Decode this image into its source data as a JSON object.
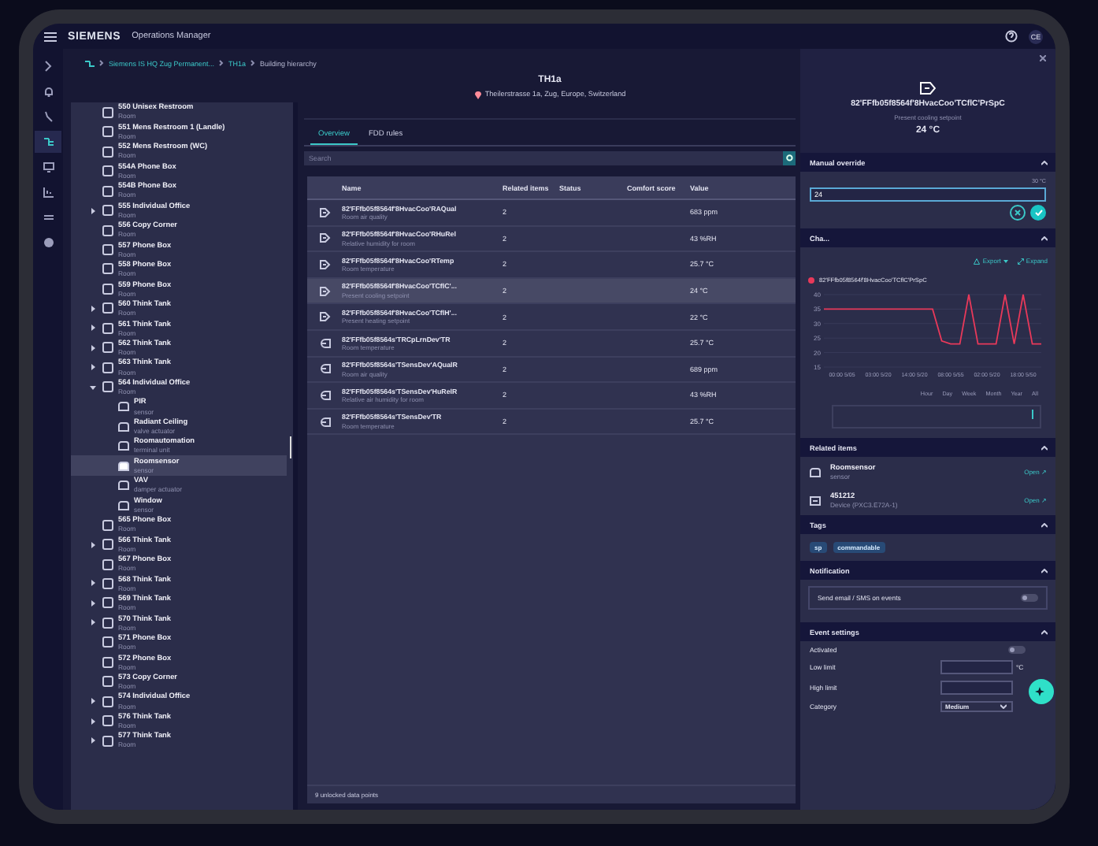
{
  "app": {
    "brand": "SIEMENS",
    "title": "Operations Manager",
    "avatar": "CE"
  },
  "nav": [
    {
      "selected": false
    },
    {
      "selected": false
    },
    {
      "selected": false
    },
    {
      "selected": true
    },
    {
      "selected": false
    },
    {
      "selected": false
    },
    {
      "selected": false
    },
    {
      "selected": false
    }
  ],
  "breadcrumb": [
    "Siemens IS HQ Zug Permanent...",
    "TH1a",
    "Building hierarchy"
  ],
  "tree": [
    {
      "name": "550 Unisex Restroom",
      "type": "Room",
      "expandable": false,
      "expanded": false,
      "selected": false
    },
    {
      "name": "551 Mens Restroom 1 (Landle)",
      "type": "Room",
      "expandable": false,
      "expanded": false,
      "selected": false
    },
    {
      "name": "552 Mens Restroom (WC)",
      "type": "Room",
      "expandable": false,
      "expanded": false,
      "selected": false
    },
    {
      "name": "554A Phone Box",
      "type": "Room",
      "expandable": false,
      "expanded": false,
      "selected": false
    },
    {
      "name": "554B Phone Box",
      "type": "Room",
      "expandable": false,
      "expanded": false,
      "selected": false
    },
    {
      "name": "555 Individual Office",
      "type": "Room",
      "expandable": true,
      "expanded": false,
      "selected": false
    },
    {
      "name": "556 Copy Corner",
      "type": "Room",
      "expandable": false,
      "expanded": false,
      "selected": false
    },
    {
      "name": "557 Phone Box",
      "type": "Room",
      "expandable": false,
      "expanded": false,
      "selected": false
    },
    {
      "name": "558 Phone Box",
      "type": "Room",
      "expandable": false,
      "expanded": false,
      "selected": false
    },
    {
      "name": "559 Phone Box",
      "type": "Room",
      "expandable": false,
      "expanded": false,
      "selected": false
    },
    {
      "name": "560 Think Tank",
      "type": "Room",
      "expandable": true,
      "expanded": false,
      "selected": false
    },
    {
      "name": "561 Think Tank",
      "type": "Room",
      "expandable": true,
      "expanded": false,
      "selected": false
    },
    {
      "name": "562 Think Tank",
      "type": "Room",
      "expandable": true,
      "expanded": false,
      "selected": false
    },
    {
      "name": "563 Think Tank",
      "type": "Room",
      "expandable": true,
      "expanded": false,
      "selected": false
    },
    {
      "name": "564 Individual Office",
      "type": "Room",
      "expandable": true,
      "expanded": true,
      "selected": false,
      "children": [
        {
          "name": "PIR",
          "type": "sensor",
          "selected": false
        },
        {
          "name": "Radiant Ceiling",
          "type": "valve actuator",
          "selected": false
        },
        {
          "name": "Roomautomation",
          "type": "terminal unit",
          "selected": false
        },
        {
          "name": "Roomsensor",
          "type": "sensor",
          "selected": true
        },
        {
          "name": "VAV",
          "type": "damper actuator",
          "selected": false
        },
        {
          "name": "Window",
          "type": "sensor",
          "selected": false
        }
      ]
    },
    {
      "name": "565 Phone Box",
      "type": "Room",
      "expandable": false,
      "expanded": false,
      "selected": false
    },
    {
      "name": "566 Think Tank",
      "type": "Room",
      "expandable": true,
      "expanded": false,
      "selected": false
    },
    {
      "name": "567 Phone Box",
      "type": "Room",
      "expandable": false,
      "expanded": false,
      "selected": false
    },
    {
      "name": "568 Think Tank",
      "type": "Room",
      "expandable": true,
      "expanded": false,
      "selected": false
    },
    {
      "name": "569 Think Tank",
      "type": "Room",
      "expandable": true,
      "expanded": false,
      "selected": false
    },
    {
      "name": "570 Think Tank",
      "type": "Room",
      "expandable": true,
      "expanded": false,
      "selected": false
    },
    {
      "name": "571 Phone Box",
      "type": "Room",
      "expandable": false,
      "expanded": false,
      "selected": false
    },
    {
      "name": "572 Phone Box",
      "type": "Room",
      "expandable": false,
      "expanded": false,
      "selected": false
    },
    {
      "name": "573 Copy Corner",
      "type": "Room",
      "expandable": false,
      "expanded": false,
      "selected": false
    },
    {
      "name": "574 Individual Office",
      "type": "Room",
      "expandable": true,
      "expanded": false,
      "selected": false
    },
    {
      "name": "576 Think Tank",
      "type": "Room",
      "expandable": true,
      "expanded": false,
      "selected": false
    },
    {
      "name": "577 Think Tank",
      "type": "Room",
      "expandable": true,
      "expanded": false,
      "selected": false
    }
  ],
  "header": {
    "title": "TH1a",
    "address": "Theilerstrasse 1a, Zug, Europe, Switzerland"
  },
  "tabs": [
    {
      "label": "Overview",
      "selected": true
    },
    {
      "label": "FDD rules",
      "selected": false
    }
  ],
  "search": {
    "placeholder": "Search"
  },
  "table": {
    "columns": [
      "Name",
      "Related items",
      "Status",
      "Comfort score",
      "Value"
    ],
    "rows": [
      {
        "kind": "output",
        "name": "82'FFfb05f8564f'8HvacCoo'RAQual",
        "description": "Room air quality",
        "related": "2",
        "value": "683 ppm",
        "selected": false
      },
      {
        "kind": "output",
        "name": "82'FFfb05f8564f'8HvacCoo'RHuRel",
        "description": "Relative humidity for room",
        "related": "2",
        "value": "43 %RH",
        "selected": false
      },
      {
        "kind": "output",
        "name": "82'FFfb05f8564f'8HvacCoo'RTemp",
        "description": "Room temperature",
        "related": "2",
        "value": "25.7 °C",
        "selected": false
      },
      {
        "kind": "output",
        "name": "82'FFfb05f8564f'8HvacCoo'TCflC'...",
        "description": "Present cooling setpoint",
        "related": "2",
        "value": "24 °C",
        "selected": true
      },
      {
        "kind": "output",
        "name": "82'FFfb05f8564f'8HvacCoo'TCflH'...",
        "description": "Present heating setpoint",
        "related": "2",
        "value": "22 °C",
        "selected": false
      },
      {
        "kind": "input",
        "name": "82'FFfb05f8564s'TRCpLrnDev'TR",
        "description": "Room temperature",
        "related": "2",
        "value": "25.7 °C",
        "selected": false
      },
      {
        "kind": "input",
        "name": "82'FFfb05f8564s'TSensDev'AQualR",
        "description": "Room air quality",
        "related": "2",
        "value": "689 ppm",
        "selected": false
      },
      {
        "kind": "input",
        "name": "82'FFfb05f8564s'TSensDev'HuRelR",
        "description": "Relative air humidity for room",
        "related": "2",
        "value": "43 %RH",
        "selected": false
      },
      {
        "kind": "input",
        "name": "82'FFfb05f8564s'TSensDev'TR",
        "description": "Room temperature",
        "related": "2",
        "value": "25.7 °C",
        "selected": false
      }
    ],
    "footer": "9 unlocked data points"
  },
  "detail": {
    "name": "82'FFfb05f8564f'8HvacCoo'TCflC'PrSpC",
    "description": "Present cooling setpoint",
    "value": "24 °C",
    "override": {
      "title": "Manual override",
      "hint": "30 °C",
      "value": "24"
    },
    "chart_section": {
      "title": "Cha...",
      "export": "Export",
      "expand": "Expand",
      "chart_data": {
        "type": "line",
        "categories": [
          null,
          null,
          "00:00 5/05",
          null,
          null,
          null,
          "03:00 5/20",
          null,
          null,
          null,
          "14:00 5/20",
          null,
          null,
          null,
          "08:00 5/55",
          null,
          null,
          null,
          "02:00 5/20",
          null,
          null,
          null,
          "18:00 5/50",
          null,
          null
        ],
        "series": [
          {
            "name": "82'FFfb05f8564f'8HvacCoo'TCflC'PrSpC",
            "color": "#e8395a",
            "values": [
              35,
              35,
              35,
              35,
              35,
              35,
              35,
              35,
              35,
              35,
              35,
              35,
              35,
              24,
              23,
              23,
              40,
              23,
              23,
              23,
              40,
              23,
              40,
              23,
              23
            ]
          }
        ],
        "ylim": [
          15,
          40
        ],
        "grid": true,
        "yticks": [
          15,
          20,
          25,
          30,
          35,
          40
        ]
      },
      "ranges": [
        {
          "label": "Hour",
          "selected": false
        },
        {
          "label": "Day",
          "selected": false
        },
        {
          "label": "Week",
          "selected": false
        },
        {
          "label": "Month",
          "selected": false
        },
        {
          "label": "Year",
          "selected": false
        },
        {
          "label": "All",
          "selected": false
        }
      ]
    },
    "related": {
      "title": "Related items",
      "items": [
        {
          "kind": "sensor",
          "name": "Roomsensor",
          "type": "sensor",
          "action": "Open ↗"
        },
        {
          "kind": "device",
          "name": "451212",
          "type": "Device (PXC3.E72A-1)",
          "action": "Open ↗"
        }
      ]
    },
    "tags": {
      "title": "Tags",
      "items": [
        "sp",
        "commandable"
      ]
    },
    "notification": {
      "title": "Notification",
      "label": "Send email / SMS on events",
      "on": false
    },
    "events": {
      "title": "Event settings",
      "activated_label": "Activated",
      "activated": false,
      "low_label": "Low limit",
      "unit": "°C",
      "high_label": "High limit",
      "category_label": "Category",
      "category": "Medium"
    }
  }
}
